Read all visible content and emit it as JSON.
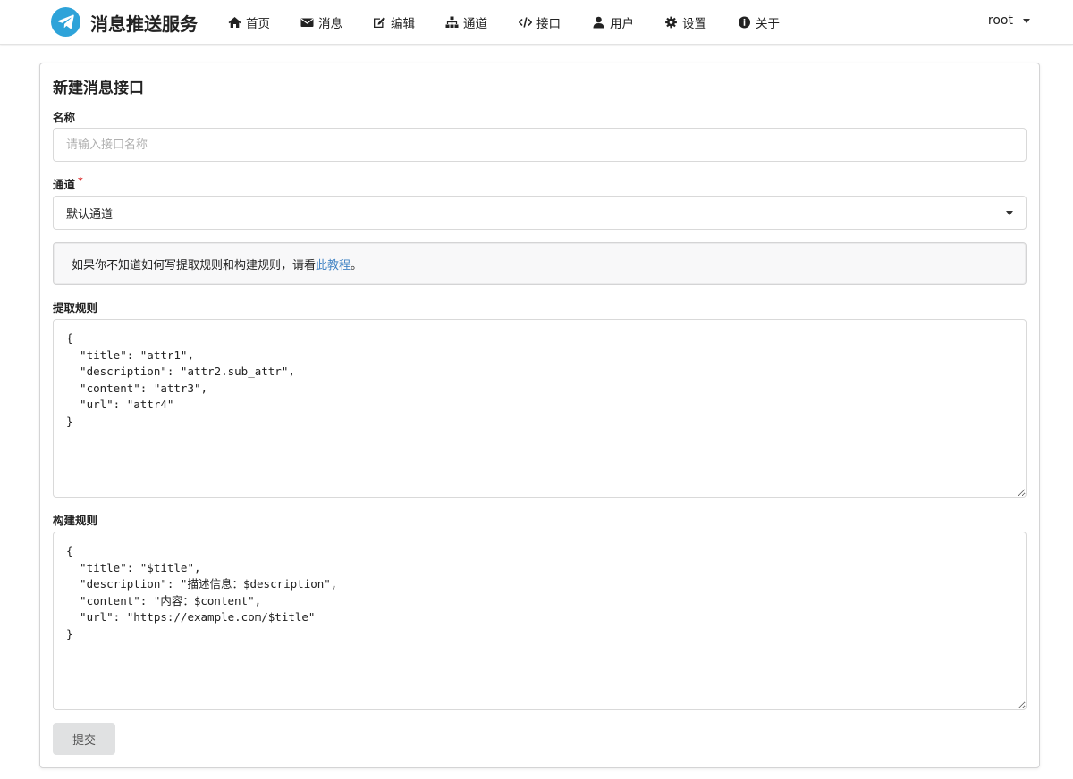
{
  "app": {
    "brand": "消息推送服务"
  },
  "nav": {
    "items": [
      {
        "label": "首页",
        "icon": "home-icon"
      },
      {
        "label": "消息",
        "icon": "envelope-icon"
      },
      {
        "label": "编辑",
        "icon": "edit-icon"
      },
      {
        "label": "通道",
        "icon": "sitemap-icon"
      },
      {
        "label": "接口",
        "icon": "code-icon"
      },
      {
        "label": "用户",
        "icon": "user-icon"
      },
      {
        "label": "设置",
        "icon": "gear-icon"
      },
      {
        "label": "关于",
        "icon": "info-icon"
      }
    ],
    "user": "root"
  },
  "form": {
    "title": "新建消息接口",
    "name": {
      "label": "名称",
      "placeholder": "请输入接口名称",
      "value": ""
    },
    "channel": {
      "label": "通道",
      "required_mark": "*",
      "value": "默认通道"
    },
    "notice": {
      "text_before": "如果你不知道如何写提取规则和构建规则，请看",
      "link": "此教程",
      "text_after": "。"
    },
    "extract_rule": {
      "label": "提取规则",
      "value": "{\n  \"title\": \"attr1\",\n  \"description\": \"attr2.sub_attr\",\n  \"content\": \"attr3\",\n  \"url\": \"attr4\"\n}"
    },
    "build_rule": {
      "label": "构建规则",
      "value": "{\n  \"title\": \"$title\",\n  \"description\": \"描述信息：$description\",\n  \"content\": \"内容：$content\",\n  \"url\": \"https://example.com/$title\"\n}"
    },
    "submit_label": "提交"
  },
  "colors": {
    "brand_icon": "#2ea3d9",
    "link": "#4183c4",
    "required": "#db2828",
    "button_bg": "#e0e1e2"
  }
}
